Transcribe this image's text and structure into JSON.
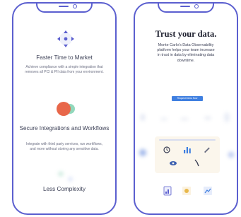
{
  "left_screen": {
    "heading_1": "Faster Time to Market",
    "body_1": "Achieve compliance with a simple integration that removes all PCI & PII data from your environment.",
    "heading_2": "Secure Integrations and Workflows",
    "body_2": "Integrate with third party services, run workflows, and more without storing any sensitive data.",
    "heading_3": "Less Complexity"
  },
  "right_screen": {
    "title": "Trust your data.",
    "body": "Monte Carlo's Data Observability platform helps your team increase in trust in data by eliminating data downtime.",
    "cta_label": "Request Demo Now"
  },
  "icons": {
    "move": "move-arrows-icon",
    "circles": "overlapping-circles-icon",
    "clock": "clock-icon",
    "bars": "bar-chart-icon",
    "pen": "pen-icon",
    "eye": "eye-icon",
    "wrench": "wrench-icon"
  },
  "colors": {
    "frame": "#5b5fcf",
    "accent_orange": "#e8674a",
    "accent_teal": "#7fd1b0",
    "cta_blue": "#3f7fe0"
  }
}
